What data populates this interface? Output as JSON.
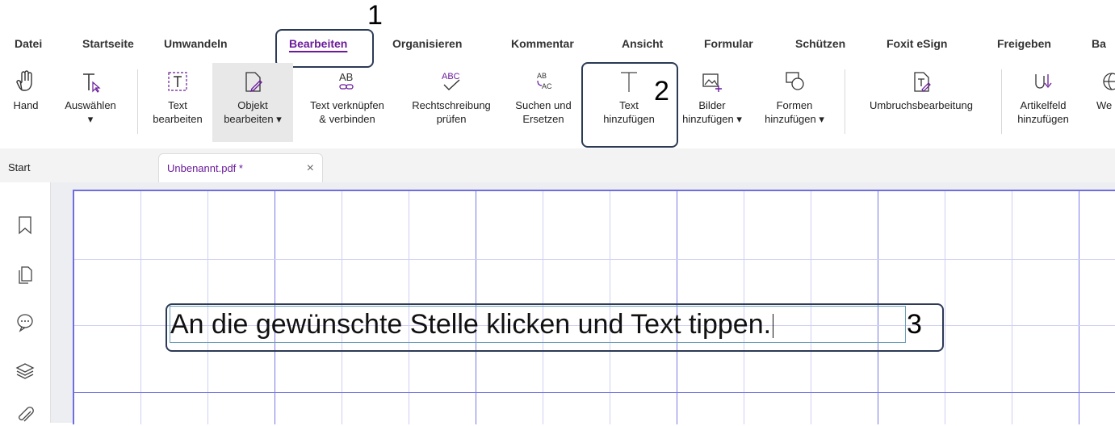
{
  "menu": [
    "Datei",
    "Startseite",
    "Umwandeln",
    "Bearbeiten",
    "Organisieren",
    "Kommentar",
    "Ansicht",
    "Formular",
    "Schützen",
    "Foxit eSign",
    "Freigeben",
    "Ba"
  ],
  "active_menu": "Bearbeiten",
  "ribbon": {
    "hand": {
      "line1": "Hand"
    },
    "select": {
      "line1": "Auswählen",
      "line2": "▾"
    },
    "edit_text": {
      "line1": "Text",
      "line2": "bearbeiten"
    },
    "edit_object": {
      "line1": "Objekt",
      "line2": "bearbeiten ▾"
    },
    "link_text": {
      "line1": "Text verknüpfen",
      "line2": "& verbinden",
      "icon_text": "AB"
    },
    "spellcheck": {
      "line1": "Rechtschreibung",
      "line2": "prüfen",
      "icon_text": "ABC"
    },
    "find_replace": {
      "line1": "Suchen und",
      "line2": "Ersetzen",
      "icon_text_a": "AB",
      "icon_text_b": "AC"
    },
    "add_text": {
      "line1": "Text",
      "line2": "hinzufügen"
    },
    "add_images": {
      "line1": "Bilder",
      "line2": "hinzufügen ▾"
    },
    "add_shapes": {
      "line1": "Formen",
      "line2": "hinzufügen ▾"
    },
    "reflow": {
      "line1": "Umbruchsbearbeitung"
    },
    "article": {
      "line1": "Artikelfeld",
      "line2": "hinzufügen"
    },
    "web": {
      "line1": "We"
    }
  },
  "callouts": [
    "1",
    "2",
    "3"
  ],
  "tabs": {
    "start": "Start",
    "file": "Unbenannt.pdf *",
    "close": "×"
  },
  "document": {
    "text": "An die gewünschte Stelle klicken und Text tippen."
  },
  "colors": {
    "accent": "#6a1b9a",
    "callout_border": "#2b3a55",
    "grid_major": "#7a7ae6",
    "grid_minor": "#cfcff5"
  }
}
